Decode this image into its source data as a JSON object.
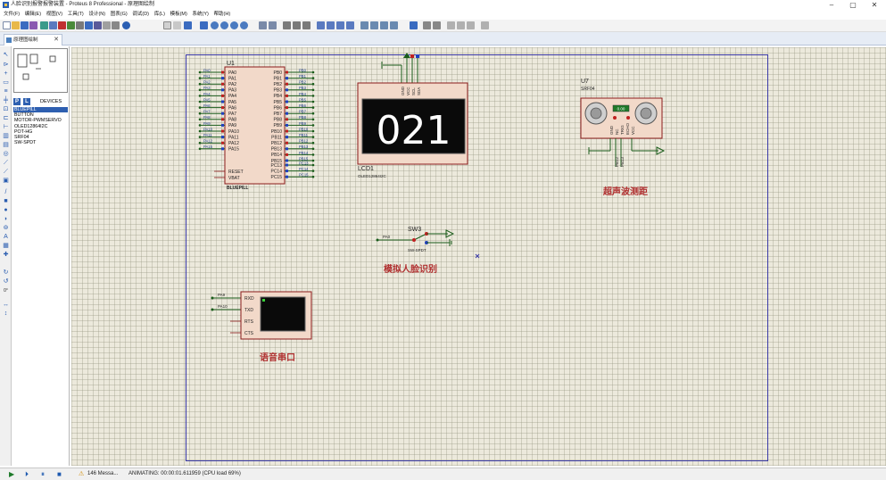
{
  "window": {
    "title": "人脸识别报警报警装置 - Proteus 8 Professional - 原理图绘制",
    "minimize": "–",
    "maximize": "▢",
    "close": "✕"
  },
  "menu": [
    "文件(F)",
    "编辑(E)",
    "视图(V)",
    "工具(T)",
    "设计(N)",
    "图表(G)",
    "调试(D)",
    "库(L)",
    "模板(M)",
    "系统(Y)",
    "帮助(H)"
  ],
  "tab": {
    "label": "原理图绘制",
    "close": "✕"
  },
  "devices": {
    "header": "DEVICES",
    "p_label": "P",
    "l_label": "L",
    "items": [
      "BLUEPILL",
      "BUTTON",
      "MOTOR-PWMSERVO",
      "OLED12864I2C",
      "POT-HG",
      "SRF04",
      "SW-SPDT"
    ],
    "selected": "BLUEPILL"
  },
  "schematic": {
    "u1": {
      "ref": "U1",
      "name": "BLUEPILL",
      "left_pins": [
        "PA0",
        "PA1",
        "PA2",
        "PA3",
        "PA4",
        "PA5",
        "PA6",
        "PA7",
        "PA8",
        "PA9",
        "PA10",
        "PA11",
        "PA12",
        "PA15"
      ],
      "left_nets": [
        "PA0",
        "PA1",
        "PA2",
        "PA3",
        "PA4",
        "PA5",
        "PA6",
        "PA7",
        "PA8",
        "PA9",
        "PA10",
        "PA11",
        "PA12",
        "PA15"
      ],
      "right_pins": [
        "PB0",
        "PB1",
        "PB2",
        "PB3",
        "PB4",
        "PB5",
        "PB6",
        "PB7",
        "PB8",
        "PB9",
        "PB10",
        "PB11",
        "PB12",
        "PB13",
        "PB14",
        "PB15"
      ],
      "right_nets": [
        "PB0",
        "PB1",
        "PB2",
        "PB3",
        "PB4",
        "PB5",
        "PB6",
        "PB7",
        "PB8",
        "PB9",
        "PB10",
        "PB11",
        "PB12",
        "PB13",
        "PB14",
        "PB15"
      ],
      "bottom_left_pins": [
        "RESET",
        "VBAT"
      ],
      "bottom_right_pins": [
        "PC13",
        "PC14",
        "PC15"
      ],
      "bottom_right_nets": [
        "PC13",
        "PC14",
        "PC15"
      ]
    },
    "lcd1": {
      "ref": "LCD1",
      "name": "OLED12864I2C",
      "display_text": "021",
      "pins": [
        "GND",
        "VCC",
        "SCL",
        "SDA"
      ]
    },
    "u7": {
      "ref": "U7",
      "name": "SRF04",
      "pins": [
        "GND",
        "NC",
        "TRIG",
        "ECHO",
        "VCC"
      ],
      "nets": [
        "PB12",
        "PB13"
      ],
      "lcd_text": "0.00"
    },
    "sw3": {
      "ref": "SW3",
      "name": "SW-SPDT",
      "net": "PA0"
    },
    "uart": {
      "pins": [
        "RXD",
        "TXD",
        "RTS",
        "CTS"
      ],
      "nets": [
        "PA9",
        "PA10"
      ]
    },
    "labels": {
      "ultrasonic": "超声波测距",
      "face": "模拟人脸识别",
      "voice": "语音串口"
    }
  },
  "status": {
    "messages": "146 Messa...",
    "animating": "ANIMATING: 00:00:01.611959 (CPU load 69%)"
  },
  "colors": {
    "canvas": "#ece9dc",
    "component_fill": "#f2d9c9",
    "component_stroke": "#8b1a1a",
    "wire": "#1a5c1a",
    "sheet_border": "#3a3aa8",
    "label_red": "#b03030"
  }
}
